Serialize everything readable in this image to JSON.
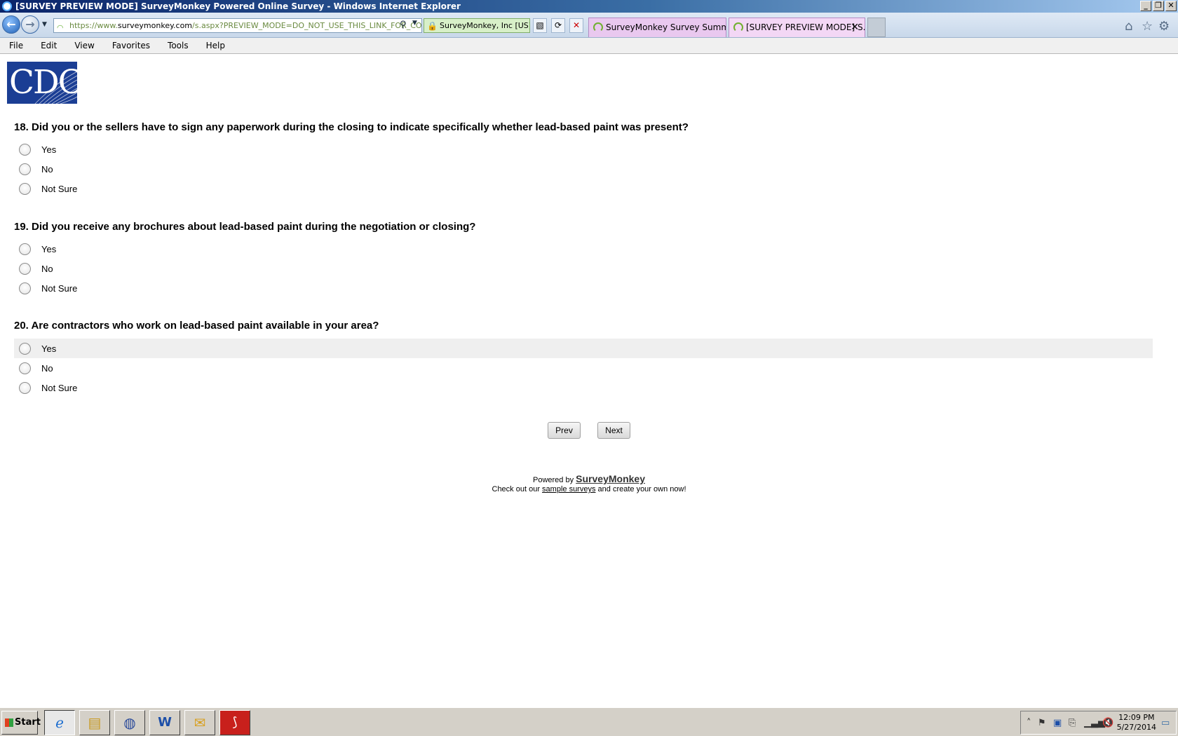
{
  "window": {
    "title": "[SURVEY PREVIEW MODE] SurveyMonkey Powered Online Survey - Windows Internet Explorer",
    "min_glyph": "_",
    "restore_glyph": "❐",
    "close_glyph": "✕"
  },
  "browser": {
    "back_glyph": "←",
    "forward_glyph": "→",
    "address_scheme": "https://www.",
    "address_domain": "surveymonkey.com",
    "address_path": "/s.aspx?PREVIEW_MODE=DO_NOT_USE_THIS_LINK_FOR_COLL",
    "security_label": "SurveyMonkey, Inc [US]",
    "tabs": [
      {
        "label": "SurveyMonkey Survey Summar..."
      },
      {
        "label": "[SURVEY PREVIEW MODE] S..."
      }
    ],
    "tab_close_glyph": "✕"
  },
  "menu": [
    "File",
    "Edit",
    "View",
    "Favorites",
    "Tools",
    "Help"
  ],
  "logo": {
    "text": "CDC"
  },
  "questions": [
    {
      "text": "18. Did you or the sellers have to sign any paperwork during the closing to indicate specifically whether lead-based paint was present?",
      "options": [
        "Yes",
        "No",
        "Not Sure"
      ]
    },
    {
      "text": "19. Did you receive any brochures about lead-based paint during the negotiation or closing?",
      "options": [
        "Yes",
        "No",
        "Not Sure"
      ]
    },
    {
      "text": "20. Are contractors who work on lead-based paint available in your area?",
      "options": [
        "Yes",
        "No",
        "Not Sure"
      ]
    }
  ],
  "nav": {
    "prev_label": "Prev",
    "next_label": "Next"
  },
  "footer": {
    "powered_by": "Powered by",
    "brand": "SurveyMonkey",
    "check_prefix": "Check out our",
    "sample_link": "sample surveys",
    "check_suffix": "and create your own now!"
  },
  "taskbar": {
    "start_label": "Start",
    "time": "12:09 PM",
    "date": "5/27/2014"
  }
}
